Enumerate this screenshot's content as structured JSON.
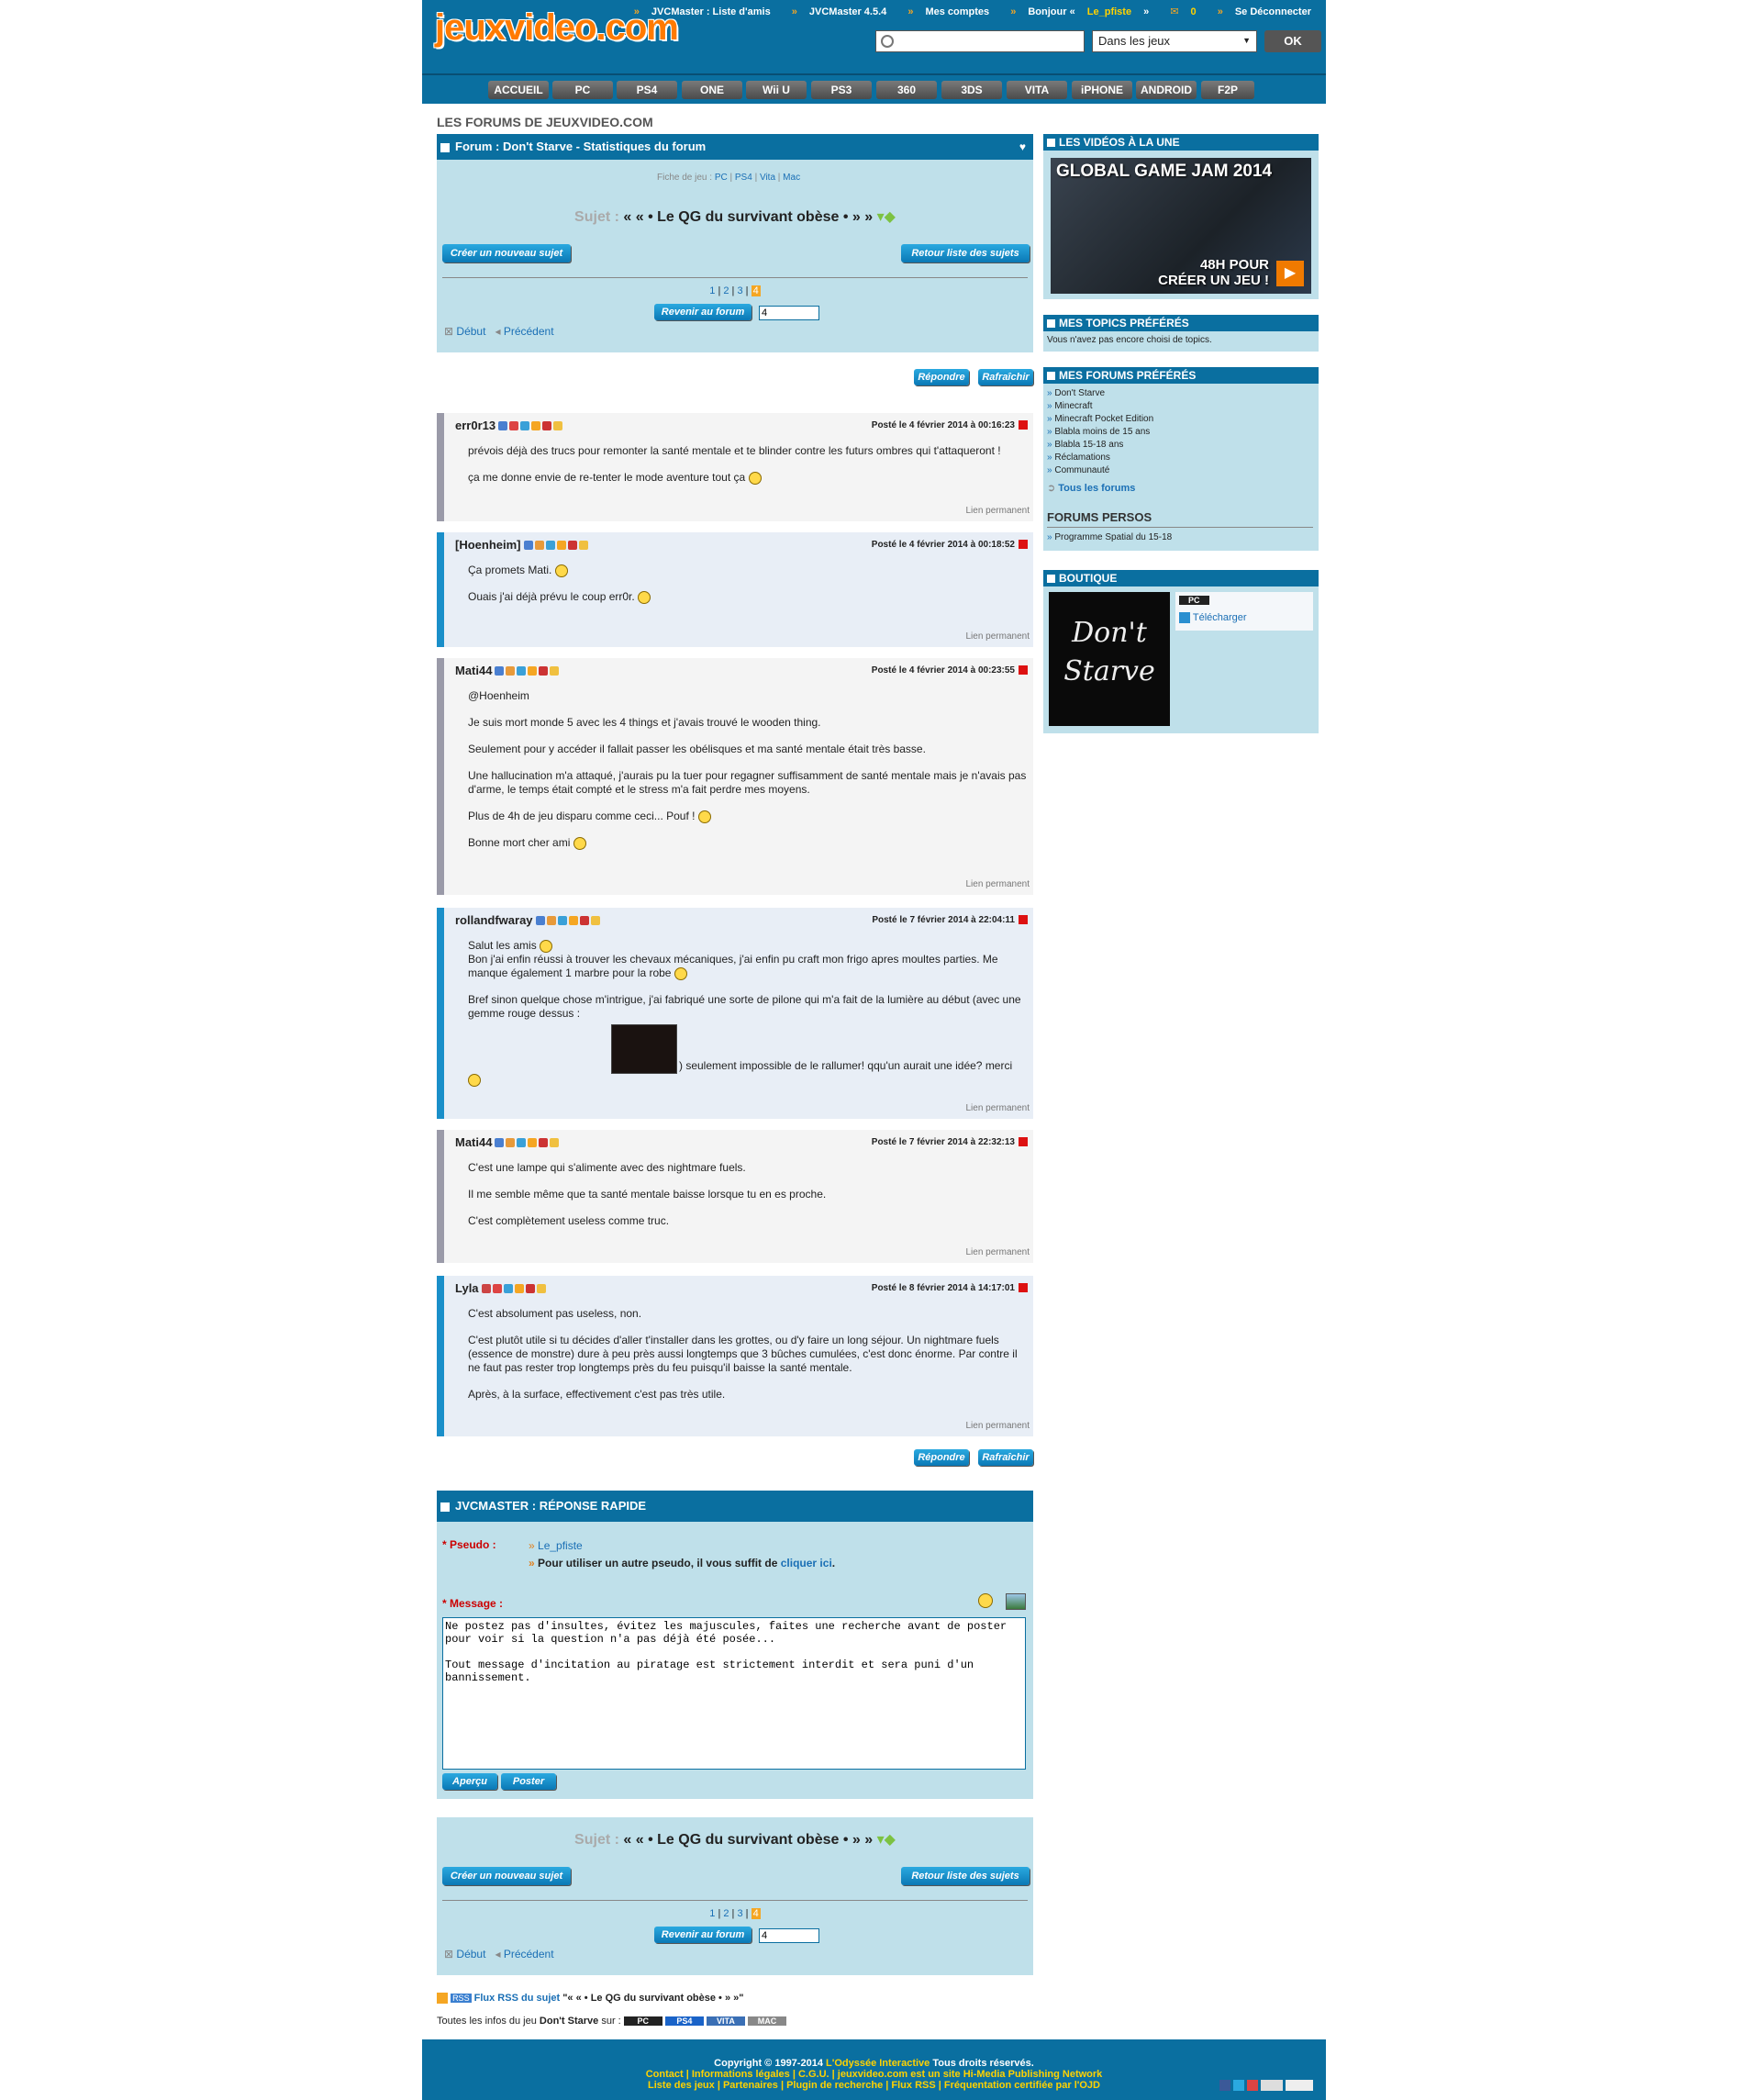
{
  "header": {
    "logo": "jeuxvideo.com",
    "links": [
      "JVCMaster : Liste d'amis",
      "JVCMaster 4.5.4",
      "Mes comptes"
    ],
    "greeting_prefix": "Bonjour «",
    "username": "Le_pfiste",
    "greeting_suffix": "»",
    "mail_count": "0",
    "logout": "Se Déconnecter",
    "search_placeholder": "",
    "search_scope": "Dans les jeux",
    "ok": "OK"
  },
  "nav": [
    "ACCUEIL",
    "PC",
    "PS4",
    "ONE",
    "Wii U",
    "PS3",
    "360",
    "3DS",
    "VITA",
    "iPHONE",
    "ANDROID",
    "F2P"
  ],
  "breadcrumb": "LES FORUMS DE JEUXVIDEO.COM",
  "forum": {
    "title": "Forum : Don't Starve - Statistiques du forum",
    "fiche_label": "Fiche de jeu :",
    "platforms": [
      "PC",
      "PS4",
      "Vita",
      "Mac"
    ],
    "sujet_label": "Sujet :",
    "sujet": "« « • Le QG du survivant obèse • » »",
    "new_topic": "Créer un nouveau sujet",
    "back_list": "Retour liste des sujets",
    "pages": [
      "1",
      "2",
      "3",
      "4"
    ],
    "current_page": "4",
    "back_forum": "Revenir au forum",
    "page_input": "4",
    "start": "Début",
    "prev": "Précédent",
    "reply": "Répondre",
    "refresh": "Rafraîchir",
    "permalink": "Lien permanent"
  },
  "posts": [
    {
      "author": "err0r13",
      "date": "Posté le 4 février 2014 à 00:16:23",
      "lines": [
        "prévois déjà des trucs pour remonter la santé mentale et te blinder contre les futurs ombres qui t'attaqueront !",
        "ça me donne envie de re-tenter le mode aventure tout ça"
      ]
    },
    {
      "author": "[Hoenheim]",
      "date": "Posté le 4 février 2014 à 00:18:52",
      "lines": [
        "Ça promets Mati.",
        "Ouais j'ai déjà prévu le coup err0r."
      ]
    },
    {
      "author": "Mati44",
      "date": "Posté le 4 février 2014 à 00:23:55",
      "lines": [
        "@Hoenheim",
        "Je suis mort monde 5 avec les 4 things et j'avais trouvé le wooden thing.",
        "Seulement pour y accéder il fallait passer les obélisques et ma santé mentale était très basse.",
        "Une hallucination m'a attaqué, j'aurais pu la tuer pour regagner suffisamment de santé mentale mais je n'avais pas d'arme, le temps était compté et le stress m'a fait perdre mes moyens.",
        "Plus de 4h de jeu disparu comme ceci... Pouf !",
        "Bonne mort cher ami"
      ]
    },
    {
      "author": "rollandfwaray",
      "date": "Posté le 7 février 2014 à 22:04:11",
      "lines": [
        "Salut les amis",
        "Bon j'ai enfin réussi à trouver les chevaux mécaniques, j'ai enfin pu craft mon frigo apres moultes parties. Me manque également 1 marbre pour la robe",
        "Bref sinon quelque chose m'intrigue, j'ai fabriqué une sorte de pilone qui m'a fait de la lumière au début (avec une gemme rouge dessus :",
        ") seulement impossible de le rallumer! qqu'un aurait une idée? merci"
      ]
    },
    {
      "author": "Mati44",
      "date": "Posté le 7 février 2014 à 22:32:13",
      "lines": [
        "C'est une lampe qui s'alimente avec des nightmare fuels.",
        "Il me semble même que ta santé mentale baisse lorsque tu en es proche.",
        "C'est complètement useless comme truc."
      ]
    },
    {
      "author": "Lyla",
      "date": "Posté le 8 février 2014 à 14:17:01",
      "lines": [
        "C'est absolument pas useless, non.",
        "C'est plutôt utile si tu décides d'aller t'installer dans les grottes, ou d'y faire un long séjour. Un nightmare fuels (essence de monstre) dure à peu près aussi longtemps que 3 bûches cumulées, c'est donc énorme. Par contre il ne faut pas rester trop longtemps près du feu puisqu'il baisse la santé mentale.",
        "Après, à la surface, effectivement c'est pas très utile."
      ]
    }
  ],
  "quick_reply": {
    "title": "JVCMASTER : RÉPONSE RAPIDE",
    "pseudo_label": "* Pseudo :",
    "pseudo": "Le_pfiste",
    "alt_text": "Pour utiliser un autre pseudo, il vous suffit de",
    "alt_link": "cliquer ici",
    "message_label": "* Message :",
    "message": "Ne postez pas d'insultes, évitez les majuscules, faites une recherche avant de poster pour voir si la question n'a pas déjà été posée...\n\nTout message d'incitation au piratage est strictement interdit et sera puni d'un bannissement.",
    "preview": "Aperçu",
    "post": "Poster"
  },
  "rss": {
    "label": "Flux RSS du sujet",
    "topic": "\"« « • Le QG du survivant obèse • » »\""
  },
  "allinfo": {
    "prefix": "Toutes les infos du jeu",
    "game": "Don't Starve",
    "suffix": "sur :",
    "platforms": [
      "PC",
      "PS4",
      "VITA",
      "MAC"
    ]
  },
  "sidebar": {
    "videos_title": "LES VIDÉOS À LA UNE",
    "video_caption": "GLOBAL GAME JAM 2014",
    "video_sub1": "48H POUR",
    "video_sub2": "CRÉER UN JEU !",
    "topics_title": "MES TOPICS PRÉFÉRÉS",
    "topics_empty": "Vous n'avez pas encore choisi de topics.",
    "forums_title": "MES FORUMS PRÉFÉRÉS",
    "forums": [
      "Don't Starve",
      "Minecraft",
      "Minecraft Pocket Edition",
      "Blabla moins de 15 ans",
      "Blabla 15-18 ans",
      "Réclamations",
      "Communauté"
    ],
    "all_forums": "Tous les forums",
    "perso_title": "FORUMS PERSOS",
    "perso": [
      "Programme Spatial du 15-18"
    ],
    "shop_title": "BOUTIQUE",
    "shop_platform": "PC",
    "shop_download": "Télécharger",
    "shop_cover": "Don't Starve"
  },
  "footer": {
    "line1_a": "Copyright © 1997-2014",
    "line1_b": "L'Odyssée Interactive",
    "line1_c": "Tous droits réservés.",
    "line2": "Contact | Informations légales | C.G.U. | jeuxvideo.com est un site Hi-Media Publishing Network",
    "line3": "Liste des jeux | Partenaires | Plugin de recherche | Flux RSS | Fréquentation certifiée par l'OJD"
  },
  "colors": {
    "primary": "#0a6fa0",
    "panel": "#bfe0ea",
    "accent": "#ff7a00",
    "user": "#ffd200"
  }
}
